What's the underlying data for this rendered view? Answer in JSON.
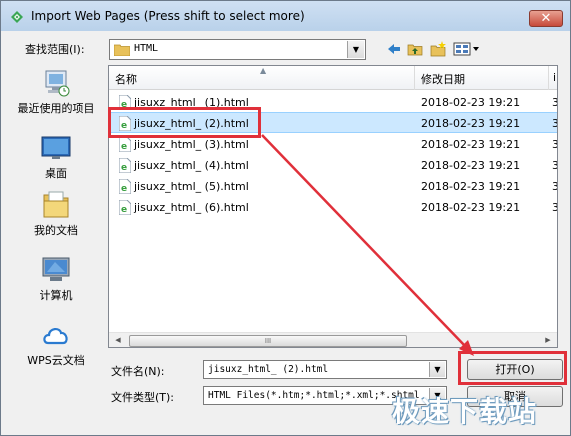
{
  "window": {
    "title": "Import Web Pages (Press shift to select more)",
    "close_label": "✕"
  },
  "lookin": {
    "label": "查找范围(I):",
    "value": "HTML"
  },
  "places": [
    {
      "label": "最近使用的项目",
      "icon": "recent-items-icon"
    },
    {
      "label": "桌面",
      "icon": "desktop-icon"
    },
    {
      "label": "我的文档",
      "icon": "documents-icon"
    },
    {
      "label": "计算机",
      "icon": "computer-icon"
    },
    {
      "label": "WPS云文档",
      "icon": "wps-cloud-icon"
    }
  ],
  "list": {
    "col_name": "名称",
    "col_date": "修改日期",
    "col_extra": "i",
    "files": [
      {
        "name": "jisuxz_html_ (1).html",
        "date": "2018-02-23 19:21",
        "extra": "3"
      },
      {
        "name": "jisuxz_html_ (2).html",
        "date": "2018-02-23 19:21",
        "extra": "3"
      },
      {
        "name": "jisuxz_html_ (3).html",
        "date": "2018-02-23 19:21",
        "extra": "3"
      },
      {
        "name": "jisuxz_html_ (4).html",
        "date": "2018-02-23 19:21",
        "extra": "3"
      },
      {
        "name": "jisuxz_html_ (5).html",
        "date": "2018-02-23 19:21",
        "extra": "3"
      },
      {
        "name": "jisuxz_html_ (6).html",
        "date": "2018-02-23 19:21",
        "extra": "3"
      }
    ],
    "selected_index": 1,
    "scroll_thumb_grip": "III"
  },
  "filename": {
    "label": "文件名(N):",
    "value": "jisuxz_html_ (2).html"
  },
  "filetype": {
    "label": "文件类型(T):",
    "value": "HTML Files(*.htm;*.html;*.xml;*.shtml"
  },
  "buttons": {
    "open": "打开(O)",
    "cancel": "取消"
  },
  "watermark": "极速下载站",
  "colors": {
    "highlight": "#e0303a",
    "selection": "#cce8ff",
    "title_bar": "#b9d1ea"
  }
}
